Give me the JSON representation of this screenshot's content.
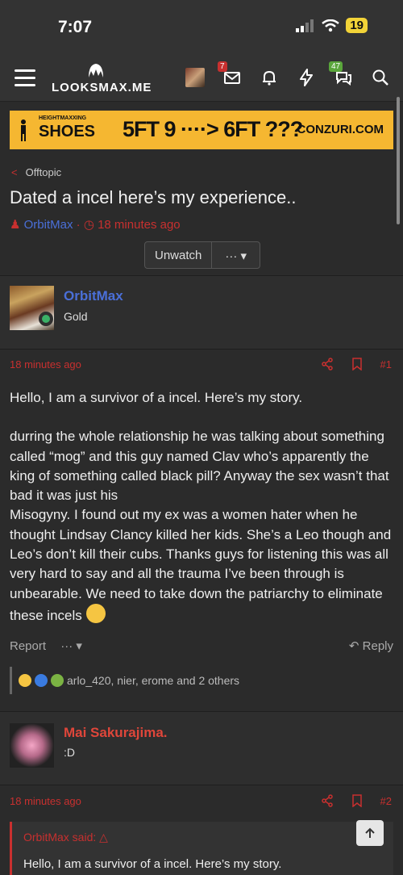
{
  "status_bar": {
    "time": "7:07",
    "battery": "19"
  },
  "nav": {
    "logo_text": "LOOKSMAX.ME",
    "alerts_badge": "7",
    "conversations_badge": "47",
    "icons": [
      "menu-icon",
      "alerts-icon",
      "bell-icon",
      "lightning-icon",
      "chat-icon",
      "search-icon"
    ]
  },
  "banner": {
    "tag": "HEIGHTMAXXING",
    "brand": "SHOES",
    "headline": "5FT 9 ····> 6FT ???",
    "site": "CONZURI.COM"
  },
  "breadcrumb": {
    "label": "Offtopic"
  },
  "thread": {
    "title": "Dated a incel here’s my experience..",
    "author": "OrbitMax",
    "sep": "·",
    "time": "18 minutes ago",
    "unwatch_label": "Unwatch",
    "more_label": "··· ▾"
  },
  "posts": [
    {
      "username": "OrbitMax",
      "user_title": "Gold",
      "time": "18 minutes ago",
      "number": "#1",
      "paragraph1": "Hello, I am a survivor of a incel. Here’s my story.",
      "paragraph2": "durring the whole relationship he was talking about something called “mog” and this guy named Clav who’s apparently the king of something called black pill? Anyway the sex wasn’t that bad it was just his",
      "paragraph3": "Misogyny. I found out my ex was a women hater when he thought Lindsay Clancy killed her kids. She’s a Leo though and Leo’s don’t kill their cubs. Thanks guys for listening this was all very hard to say and all the trauma I’ve been through is unbearable. We need to take down the patriarchy to eliminate these incels",
      "report_label": "Report",
      "more_label": "··· ▾",
      "reply_label": "Reply",
      "reactions_text": "arlo_420, nier, erome and 2 others"
    },
    {
      "username": "Mai Sakurajima.",
      "user_title": ":D",
      "time": "18 minutes ago",
      "number": "#2",
      "quote_header": "OrbitMax said:",
      "quote_text": "Hello, I am a survivor of a incel. Here’s my story."
    }
  ],
  "colors": {
    "accent": "#c8302f",
    "link": "#4a6fd8",
    "background": "#2b2b2b",
    "banner": "#f5b731"
  }
}
